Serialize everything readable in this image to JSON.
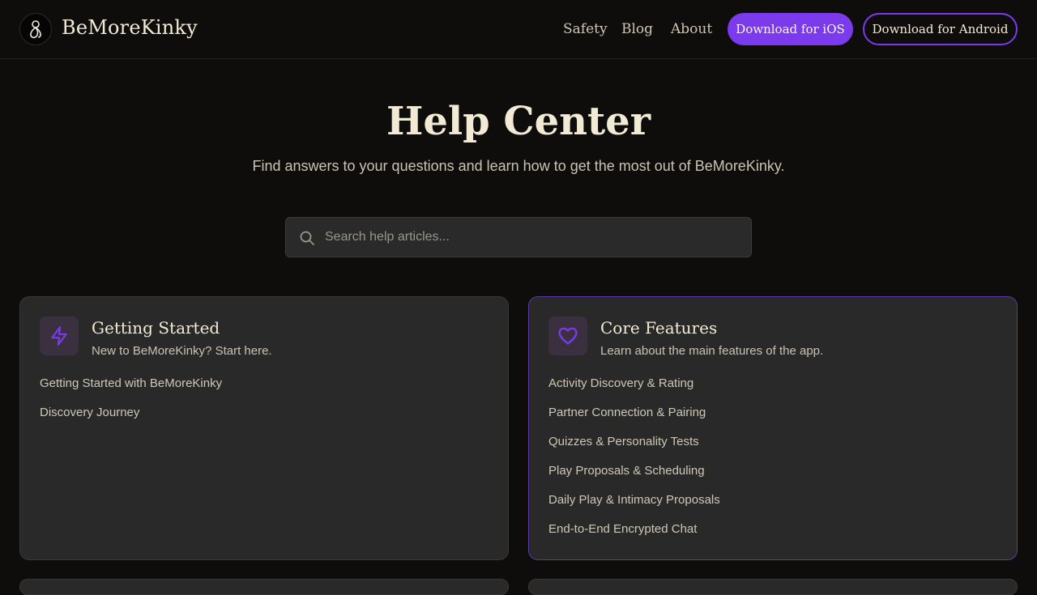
{
  "header": {
    "brand": "BeMoreKinky",
    "nav": [
      "Safety",
      "Blog",
      "About"
    ],
    "ios_button": "Download for iOS",
    "android_button": "Download for Android"
  },
  "hero": {
    "title": "Help Center",
    "subtitle": "Find answers to your questions and learn how to get the most out of BeMoreKinky."
  },
  "search": {
    "placeholder": "Search help articles..."
  },
  "categories": [
    {
      "icon": "lightning-icon",
      "title": "Getting Started",
      "description": "New to BeMoreKinky? Start here.",
      "articles": [
        "Getting Started with BeMoreKinky",
        "Discovery Journey"
      ]
    },
    {
      "icon": "heart-icon",
      "title": "Core Features",
      "description": "Learn about the main features of the app.",
      "articles": [
        "Activity Discovery & Rating",
        "Partner Connection & Pairing",
        "Quizzes & Personality Tests",
        "Play Proposals & Scheduling",
        "Daily Play & Intimacy Proposals",
        "End-to-End Encrypted Chat"
      ]
    }
  ],
  "colors": {
    "accent": "#7c3aed",
    "background": "#0f0d0b",
    "card": "#292929",
    "text_primary": "#f3ead6"
  }
}
